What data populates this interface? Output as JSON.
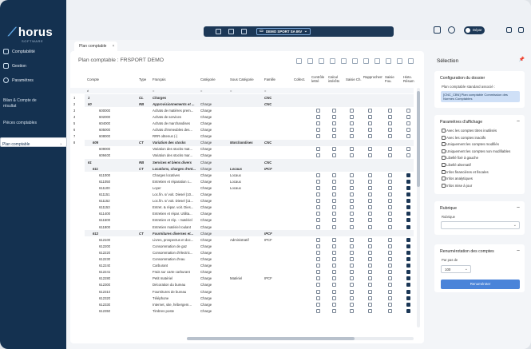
{
  "app": {
    "logo": "horus",
    "logo_sub": "SOFTWARE"
  },
  "sidebar": {
    "items": [
      {
        "label": "Comptabilité"
      },
      {
        "label": "Gestion"
      },
      {
        "label": "Paramètres"
      }
    ],
    "sub_items": [
      "Bilan & Compte de",
      "résultat"
    ],
    "links": [
      "Pièces comptables",
      "Plan comptable"
    ]
  },
  "topbar": {
    "company": "DEMO SPORT SA INV",
    "toggle_label": "Dépar"
  },
  "tabs": [
    {
      "label": "Plan comptable"
    }
  ],
  "main": {
    "title": "Plan comptable : FRSPORT DEMO",
    "columns": [
      "Compte",
      "Type",
      "Français",
      "Catégorie",
      "Sous Catégorie",
      "Famille",
      "Collect.",
      "Contrôle lettré",
      "Calcul intérêts",
      "Saisie Ch.",
      "Rapprochement",
      "Saisie Fou.",
      "Histo. Résum"
    ],
    "filter_labels": {
      "not_equal": "≠",
      "equal": "="
    },
    "level_labels": [
      "1",
      "2",
      "3",
      "4",
      "5",
      "6",
      "7",
      "8"
    ],
    "rows": [
      {
        "level": "8",
        "num": "1",
        "type": "CL",
        "label": "Charges",
        "cat": "",
        "sub": "",
        "fam": "CNC",
        "checks": []
      },
      {
        "level": "",
        "num": "60",
        "type": "RB",
        "label": "Approvisionnements et ...",
        "cat": "Charge",
        "sub": "",
        "fam": "CNC",
        "checks": []
      },
      {
        "level": "",
        "num": "600000",
        "type": "",
        "label": "Achats de matières prem...",
        "cat": "Charge",
        "sub": "",
        "fam": "",
        "checks": [
          0,
          0,
          0,
          0,
          0,
          0
        ]
      },
      {
        "level": "",
        "num": "602000",
        "type": "",
        "label": "Achats de services",
        "cat": "Charge",
        "sub": "",
        "fam": "",
        "checks": [
          0,
          0,
          0,
          0,
          0,
          0
        ]
      },
      {
        "level": "",
        "num": "604000",
        "type": "",
        "label": "Achats de marchandises",
        "cat": "Charge",
        "sub": "",
        "fam": "",
        "checks": [
          0,
          0,
          0,
          0,
          0,
          0
        ]
      },
      {
        "level": "",
        "num": "605000",
        "type": "",
        "label": "Achats d'immeubles des...",
        "cat": "Charge",
        "sub": "",
        "fam": "",
        "checks": [
          0,
          0,
          0,
          0,
          0,
          0
        ]
      },
      {
        "level": "",
        "num": "608000",
        "type": "",
        "label": "RRR obtenus (-)",
        "cat": "Charge",
        "sub": "",
        "fam": "",
        "checks": [
          0,
          0,
          0,
          0,
          0,
          0
        ]
      },
      {
        "level": "",
        "num": "609",
        "type": "CT",
        "label": "Variation des stocks",
        "cat": "Charge",
        "sub": "Marchandises",
        "fam": "CNC",
        "checks": []
      },
      {
        "level": "",
        "num": "609000",
        "type": "",
        "label": "Variation des stocks mat...",
        "cat": "Charge",
        "sub": "",
        "fam": "",
        "checks": [
          0,
          0,
          0,
          0,
          0,
          0
        ]
      },
      {
        "level": "",
        "num": "609400",
        "type": "",
        "label": "Variation des stocks mar...",
        "cat": "Charge",
        "sub": "",
        "fam": "",
        "checks": [
          0,
          0,
          0,
          0,
          0,
          0
        ]
      },
      {
        "level": "",
        "num": "61",
        "type": "RB",
        "label": "Services et biens divers",
        "cat": "Charge",
        "sub": "",
        "fam": "CNC",
        "checks": []
      },
      {
        "level": "",
        "num": "611",
        "type": "CT",
        "label": "Locations, charges d'ent...",
        "cat": "Charge",
        "sub": "Locaux",
        "fam": "IPCF",
        "checks": []
      },
      {
        "level": "",
        "num": "611000",
        "type": "",
        "label": "Charges locatives",
        "cat": "Charge",
        "sub": "Locaux",
        "fam": "",
        "checks": [
          0,
          0,
          0,
          0,
          0,
          1
        ]
      },
      {
        "level": "",
        "num": "611050",
        "type": "",
        "label": "Entretien et réparation c...",
        "cat": "Charge",
        "sub": "Locaux",
        "fam": "",
        "checks": [
          0,
          0,
          0,
          0,
          0,
          1
        ]
      },
      {
        "level": "",
        "num": "611100",
        "type": "",
        "label": "Loyer",
        "cat": "Charge",
        "sub": "Locaux",
        "fam": "",
        "checks": [
          0,
          0,
          0,
          0,
          0,
          1
        ]
      },
      {
        "level": "",
        "num": "611151",
        "type": "",
        "label": "Loc.fin. s/ voit. Diesel (10...",
        "cat": "Charge",
        "sub": "",
        "fam": "",
        "checks": [
          0,
          0,
          0,
          0,
          0,
          1
        ]
      },
      {
        "level": "",
        "num": "611152",
        "type": "",
        "label": "Loc.fin. s/ voit. Diesel (11...",
        "cat": "Charge",
        "sub": "",
        "fam": "",
        "checks": [
          0,
          0,
          0,
          0,
          0,
          1
        ]
      },
      {
        "level": "",
        "num": "611153",
        "type": "",
        "label": "Entret. & répar. voit. Dies...",
        "cat": "Charge",
        "sub": "",
        "fam": "",
        "checks": [
          0,
          0,
          0,
          0,
          0,
          1
        ]
      },
      {
        "level": "",
        "num": "611400",
        "type": "",
        "label": "Entretien et répar. Utilita...",
        "cat": "Charge",
        "sub": "",
        "fam": "",
        "checks": [
          0,
          0,
          0,
          0,
          0,
          1
        ]
      },
      {
        "level": "",
        "num": "611500",
        "type": "",
        "label": "Entretien et rép. - matériel",
        "cat": "Charge",
        "sub": "",
        "fam": "",
        "checks": [
          0,
          0,
          0,
          0,
          0,
          1
        ]
      },
      {
        "level": "",
        "num": "611800",
        "type": "",
        "label": "Entretien matériel roulant",
        "cat": "Charge",
        "sub": "",
        "fam": "",
        "checks": [
          0,
          0,
          0,
          0,
          0,
          1
        ]
      },
      {
        "level": "",
        "num": "612",
        "type": "CT",
        "label": "Fournitures diverses et...",
        "cat": "Charge",
        "sub": "",
        "fam": "IPCF",
        "checks": []
      },
      {
        "level": "",
        "num": "612100",
        "type": "",
        "label": "Livres, prospectus et doc...",
        "cat": "Charge",
        "sub": "Administratif",
        "fam": "IPCF",
        "checks": [
          0,
          0,
          0,
          0,
          0,
          1
        ]
      },
      {
        "level": "",
        "num": "612200",
        "type": "",
        "label": "Consommation de gaz",
        "cat": "Charge",
        "sub": "",
        "fam": "",
        "checks": [
          0,
          0,
          0,
          0,
          0,
          1
        ]
      },
      {
        "level": "",
        "num": "612220",
        "type": "",
        "label": "Consommation d'électric...",
        "cat": "Charge",
        "sub": "",
        "fam": "",
        "checks": [
          0,
          0,
          0,
          0,
          0,
          1
        ]
      },
      {
        "level": "",
        "num": "612230",
        "type": "",
        "label": "Consommation d'eau",
        "cat": "Charge",
        "sub": "",
        "fam": "",
        "checks": [
          0,
          0,
          0,
          0,
          0,
          1
        ]
      },
      {
        "level": "",
        "num": "612240",
        "type": "",
        "label": "Carburant",
        "cat": "Charge",
        "sub": "",
        "fam": "",
        "checks": [
          0,
          0,
          0,
          0,
          0,
          1
        ]
      },
      {
        "level": "",
        "num": "612241",
        "type": "",
        "label": "Frais sur carte carburant",
        "cat": "Charge",
        "sub": "",
        "fam": "",
        "checks": [
          0,
          0,
          0,
          0,
          0,
          1
        ]
      },
      {
        "level": "",
        "num": "612280",
        "type": "",
        "label": "Petit matériel",
        "cat": "Charge",
        "sub": "Matériel",
        "fam": "IPCF",
        "checks": [
          0,
          0,
          0,
          0,
          0,
          1
        ]
      },
      {
        "level": "",
        "num": "612300",
        "type": "",
        "label": "Décoration du bureau",
        "cat": "Charge",
        "sub": "",
        "fam": "",
        "checks": [
          0,
          0,
          0,
          0,
          0,
          1
        ]
      },
      {
        "level": "",
        "num": "612310",
        "type": "",
        "label": "Fournitures de bureau",
        "cat": "Charge",
        "sub": "",
        "fam": "",
        "checks": [
          0,
          0,
          0,
          0,
          0,
          1
        ]
      },
      {
        "level": "",
        "num": "612320",
        "type": "",
        "label": "Téléphone",
        "cat": "Charge",
        "sub": "",
        "fam": "",
        "checks": [
          0,
          0,
          0,
          0,
          0,
          1
        ]
      },
      {
        "level": "",
        "num": "612330",
        "type": "",
        "label": "Internet, site, hébergem...",
        "cat": "Charge",
        "sub": "",
        "fam": "",
        "checks": [
          0,
          0,
          0,
          0,
          0,
          1
        ]
      },
      {
        "level": "",
        "num": "612350",
        "type": "",
        "label": "Timbres poste",
        "cat": "Charge",
        "sub": "",
        "fam": "",
        "checks": [
          0,
          0,
          0,
          0,
          0,
          1
        ]
      }
    ]
  },
  "right": {
    "title": "Sélection",
    "dossier": {
      "title": "Configuration du dossier",
      "caption": "Plan comptable standard associé :",
      "chip": "[CNC_CBN] Plan comptable Commission des Normes Comptables"
    },
    "affichage": {
      "title": "Paramètres d'affichage",
      "options": [
        "Avec les comptes titres inutilisés",
        "Avec les comptes inactifs",
        "Uniquement les comptes modifiés",
        "Uniquement les comptes non modifiables",
        "Libellé fixé à gauche",
        "Libellé alternatif",
        "Infos financières et fiscales",
        "Infos analytiques",
        "Infos mise à jour"
      ]
    },
    "rubrique": {
      "title": "Rubrique",
      "label": "Rubrique"
    },
    "renum": {
      "title": "Renumérotation des comptes",
      "label": "Par pas de",
      "value": "100",
      "button": "Renuméroter"
    }
  }
}
